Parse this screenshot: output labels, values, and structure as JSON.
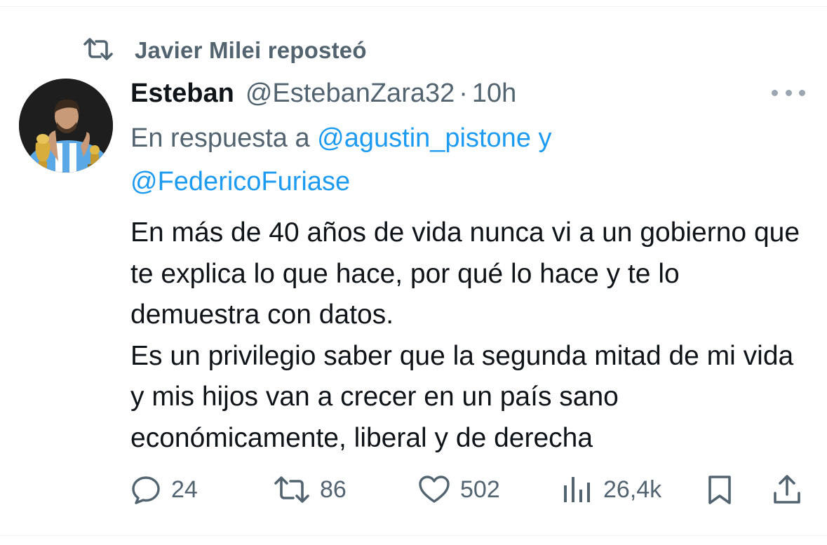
{
  "repost": {
    "label": "Javier Milei reposteó",
    "icon": "repost-icon"
  },
  "author": {
    "display_name": "Esteban",
    "handle": "@EstebanZara32",
    "separator": "·",
    "time": "10h",
    "avatar": "avatar-image"
  },
  "reply": {
    "prefix": "En respuesta a",
    "mention_1": "@agustin_pistone",
    "conjunction": "y",
    "mention_2": "@FedericoFuriase"
  },
  "tweet": {
    "text": "En más de 40 años de vida nunca vi a un gobierno que te explica lo que hace, por qué lo hace y te lo demuestra con datos.\nEs un privilegio saber que la segunda mitad de mi vida y mis hijos van a crecer en un país sano económicamente, liberal y de derecha"
  },
  "actions": {
    "replies": "24",
    "reposts": "86",
    "likes": "502",
    "views": "26,4k",
    "icons": [
      "reply-icon",
      "repost-icon",
      "like-icon",
      "views-icon",
      "bookmark-icon",
      "share-icon"
    ]
  },
  "colors": {
    "text": "#0f1419",
    "secondary": "#536471",
    "link": "#1d9bf0",
    "divider": "#eff3f4"
  }
}
